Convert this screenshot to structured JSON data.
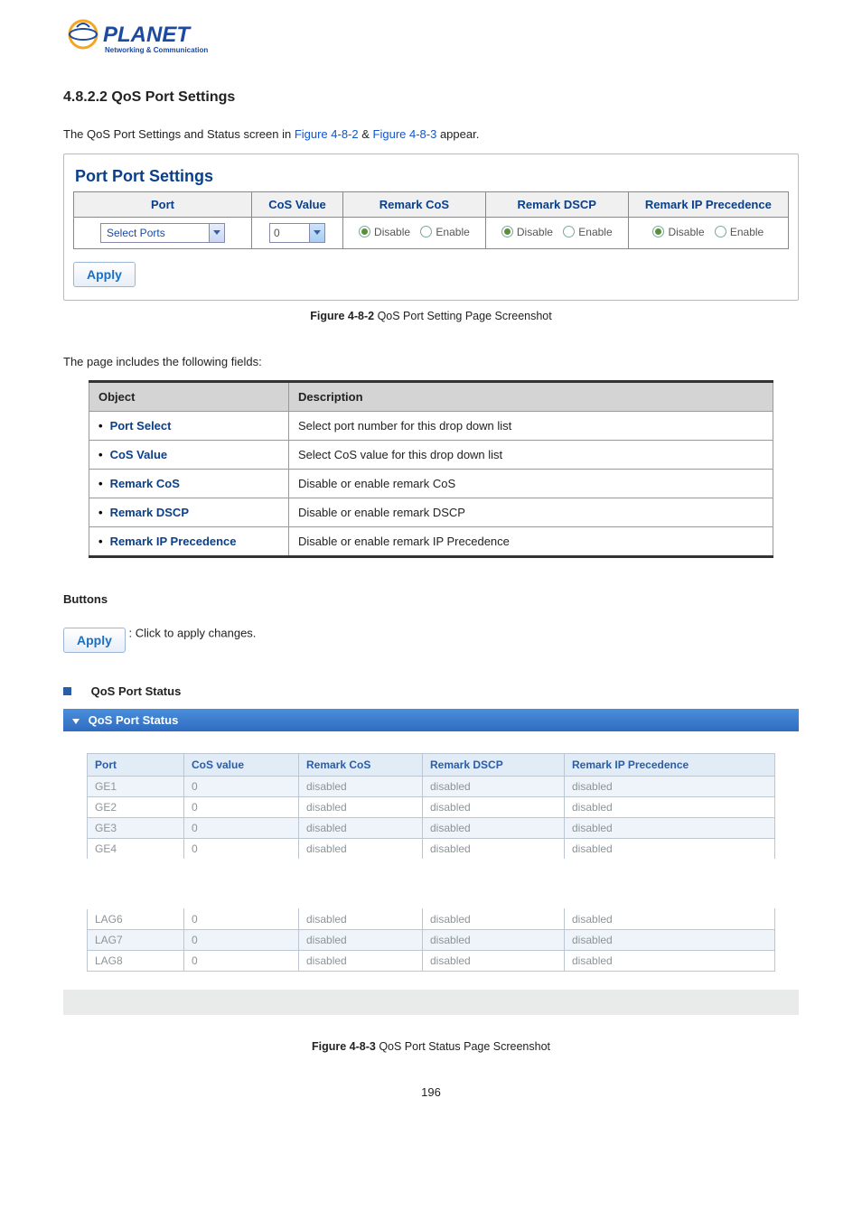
{
  "logo": {
    "brand": "PLANET",
    "tagline": "Networking & Communication"
  },
  "section_number_title": "4.8.2.2 QoS Port Settings",
  "intro": {
    "pre": "The QoS Port Settings and Status screen in ",
    "link1": "Figure 4-8-2",
    "mid": " & ",
    "link2": "Figure 4-8-3",
    "post": " appear."
  },
  "settings_panel": {
    "title": "Port Port Settings",
    "headers": [
      "Port",
      "CoS Value",
      "Remark CoS",
      "Remark DSCP",
      "Remark IP Precedence"
    ],
    "port_select_label": "Select Ports",
    "cos_value": "0",
    "radio": {
      "disable": "Disable",
      "enable": "Enable"
    },
    "apply": "Apply"
  },
  "figure1": {
    "bold": "Figure 4-8-2",
    "text": " QoS Port Setting Page Screenshot"
  },
  "fields_intro": "The page includes the following fields:",
  "obj_table": {
    "h1": "Object",
    "h2": "Description",
    "rows": [
      {
        "obj": "Port Select",
        "desc": "Select port number for this drop down list"
      },
      {
        "obj": "CoS Value",
        "desc": "Select CoS value for this drop down list"
      },
      {
        "obj": "Remark CoS",
        "desc": "Disable or enable remark CoS"
      },
      {
        "obj": "Remark DSCP",
        "desc": "Disable or enable remark DSCP"
      },
      {
        "obj": "Remark IP Precedence",
        "desc": "Disable or enable remark IP Precedence"
      }
    ]
  },
  "buttons_label": "Buttons",
  "apply_desc": ": Click to apply changes.",
  "status_heading": "QoS Port Status",
  "status_panel": {
    "title": "QoS Port Status",
    "headers": [
      "Port",
      "CoS value",
      "Remark CoS",
      "Remark DSCP",
      "Remark IP Precedence"
    ],
    "rows_top": [
      {
        "port": "GE1",
        "cos": "0",
        "rcos": "disabled",
        "rdscp": "disabled",
        "rip": "disabled"
      },
      {
        "port": "GE2",
        "cos": "0",
        "rcos": "disabled",
        "rdscp": "disabled",
        "rip": "disabled"
      },
      {
        "port": "GE3",
        "cos": "0",
        "rcos": "disabled",
        "rdscp": "disabled",
        "rip": "disabled"
      },
      {
        "port": "GE4",
        "cos": "0",
        "rcos": "disabled",
        "rdscp": "disabled",
        "rip": "disabled"
      }
    ],
    "rows_bottom": [
      {
        "port": "LAG6",
        "cos": "0",
        "rcos": "disabled",
        "rdscp": "disabled",
        "rip": "disabled"
      },
      {
        "port": "LAG7",
        "cos": "0",
        "rcos": "disabled",
        "rdscp": "disabled",
        "rip": "disabled"
      },
      {
        "port": "LAG8",
        "cos": "0",
        "rcos": "disabled",
        "rdscp": "disabled",
        "rip": "disabled"
      }
    ]
  },
  "figure2": {
    "bold": "Figure 4-8-3",
    "text": " QoS Port Status Page Screenshot"
  },
  "page_number": "196"
}
